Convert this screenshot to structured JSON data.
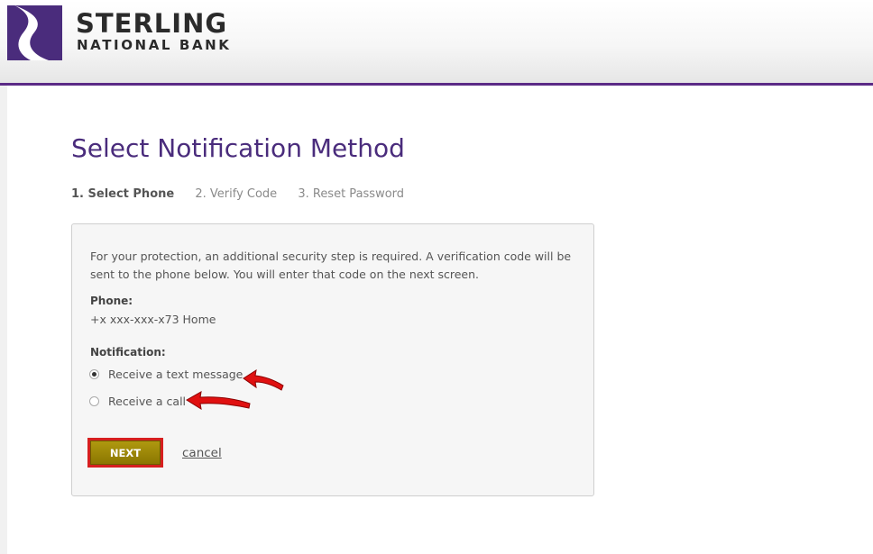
{
  "header": {
    "brand_name": "STERLING",
    "brand_sub": "NATIONAL BANK",
    "logo_color": "#4a2c7c",
    "accent_color": "#5b2a86"
  },
  "page": {
    "title": "Select Notification Method",
    "steps": [
      {
        "label": "1. Select Phone",
        "active": true
      },
      {
        "label": "2. Verify Code",
        "active": false
      },
      {
        "label": "3. Reset Password",
        "active": false
      }
    ]
  },
  "form": {
    "intro": "For your protection, an additional security step is required. A verification code will be sent to the phone below. You will enter that code on the next screen.",
    "phone_label": "Phone:",
    "phone_value": "+x xxx-xxx-x73 Home",
    "notification_label": "Notification:",
    "options": [
      {
        "label": "Receive a text message",
        "selected": true
      },
      {
        "label": "Receive a call",
        "selected": false
      }
    ],
    "next_label": "NEXT",
    "cancel_label": "cancel",
    "button_color": "#9c8600"
  },
  "annotations": {
    "arrow_color": "#e01010",
    "arrow_icon": "red-arrow-icon"
  }
}
